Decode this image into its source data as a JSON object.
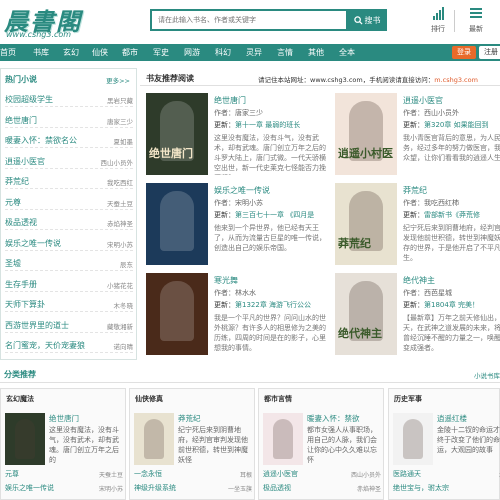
{
  "header": {
    "logo": "晨書閣",
    "logo_url": "www.cshg3.com",
    "search_placeholder": "请在此输入书名、作者或关键字",
    "search_button": "搜书",
    "rank_label": "排行",
    "latest_label": "最新"
  },
  "nav": {
    "items": [
      "首页",
      "书库",
      "玄幻",
      "仙侠",
      "都市",
      "军史",
      "网游",
      "科幻",
      "灵异",
      "言情",
      "其他",
      "全本"
    ],
    "login": "登录",
    "register": "注册"
  },
  "hot": {
    "title": "热门小说",
    "more": "更多>>",
    "items": [
      {
        "title": "校园超级学生",
        "author": "黑岩只藏"
      },
      {
        "title": "绝世唐门",
        "author": "唐家三少"
      },
      {
        "title": "暖妻入怀：禁欲名公",
        "author": "夏如墨"
      },
      {
        "title": "逍遥小医官",
        "author": "西山小员外"
      },
      {
        "title": "莽荒纪",
        "author": "我吃西红"
      },
      {
        "title": "元尊",
        "author": "天蚕土豆"
      },
      {
        "title": "极品透视",
        "author": "赤焰神圣"
      },
      {
        "title": "娱乐之唯一传说",
        "author": "宋明小苏"
      },
      {
        "title": "圣墟",
        "author": "辰东"
      },
      {
        "title": "生存手册",
        "author": "小猪花花"
      },
      {
        "title": "天师下算卦",
        "author": "木冬晓"
      },
      {
        "title": "西游世界里的道士",
        "author": "藏敬湘新"
      },
      {
        "title": "名门蜜宠，天价宠妻狼",
        "author": "诺向晴"
      }
    ]
  },
  "recommend": {
    "title": "书友推荐阅读",
    "notice_prefix": "请记住本站网址：",
    "notice_url": "www.cshg3.com",
    "notice_mid": "，手机阅读请直接访问：",
    "notice_mobile": "m.cshg3.com",
    "update_label": "更新：",
    "books": [
      {
        "name": "绝世唐门",
        "author": "作者：唐家三少",
        "chapter": "第十一章 最弱的班长",
        "desc": "这里没有魔法，没有斗气，没有武术，却有武魂。唐门创立万年之后的斗罗大陆上，唐门式微。一代天骄横空出世，新一代史莱克七怪能否力挽狂澜？",
        "cover_title": "绝世唐门",
        "cover_bg": "#2e3b2a"
      },
      {
        "name": "逍遥小医官",
        "author": "作者：西山小员外",
        "chapter": "第320章 如果能回到",
        "desc": "我小青医官背后的意思，为人民服务，经过多年的努力做医官，我不负众望，让你们看看我的逍遥人生。",
        "cover_title": "逍遥小村医",
        "cover_bg": "#f2e4da"
      },
      {
        "name": "娱乐之唯一传说",
        "author": "作者：宋明小苏",
        "chapter": "第三百七十一章 《四月是",
        "desc": "他来到一个异世界，他已经有天王了，从而为流量古巨星的唯一传说，创造出自己的娱乐帝国。",
        "cover_title": "",
        "cover_bg": "#1c3a5a"
      },
      {
        "name": "莽荒纪",
        "author": "作者：我吃西红柿",
        "chapter": "雷部新书《莽荒修",
        "desc": "纪宁死后来到阴曹地府，经判官审判发现他前世积德，转世到神魔妖怪并存的世界，于是他开启了不平凡的人生。",
        "cover_title": "莽荒纪",
        "cover_bg": "#e8e2d0"
      },
      {
        "name": "寒光舞",
        "author": "作者：林水水",
        "chapter": "第1322章 海游飞行公公",
        "desc": "我是一个平凡的世界？问问山水的世外桃源？有许多人的相思修为之美的历练，四周的时间是在的影子，心里想我的事情。",
        "cover_title": "",
        "cover_bg": "#4a2a1a"
      },
      {
        "name": "绝代神主",
        "author": "作者：西芭星城",
        "chapter": "第1804章 完美！",
        "desc": "【最新章】万年之前天修仙出，出逆天，在武神之道发展的未来，将心中曾经沉睡不醒的力量之一，唤醒灵力变成强者。",
        "cover_title": "绝代神主",
        "cover_bg": "#e6e0d8"
      }
    ]
  },
  "categories": {
    "title": "分类推荐",
    "more": "小说书库",
    "columns": [
      {
        "name": "玄幻魔法",
        "book": "绝世唐门",
        "desc": "这里没有魔法，没有斗气，没有武术，却有武魂。唐门创立万年之后的",
        "cover_bg": "#2e3b2a",
        "rows": [
          {
            "title": "元尊",
            "author": "天蚕土豆"
          },
          {
            "title": "娱乐之唯一传说",
            "author": "宋明小苏"
          }
        ]
      },
      {
        "name": "仙侠修真",
        "book": "莽荒纪",
        "desc": "纪宁死后来到阴曹地府，经判官审判发现他前世积德，转世到神魔妖怪",
        "cover_bg": "#e8e2d0",
        "rows": [
          {
            "title": "一念永恒",
            "author": "耳根"
          },
          {
            "title": "神级升级系统",
            "author": "一坐玉旗"
          }
        ]
      },
      {
        "name": "都市言情",
        "book": "暖妻入怀：禁欲",
        "desc": "都市女强人从事职场，用自己的人脉，我们会让你的心中久久难以忘怀",
        "cover_bg": "#f3e6e8",
        "rows": [
          {
            "title": "逍遥小医官",
            "author": "西山小员外"
          },
          {
            "title": "极品透视",
            "author": "赤焰神圣"
          }
        ]
      },
      {
        "name": "历史军事",
        "book": "逍遥红楼",
        "desc": "金陵十二钗的命运才，终于改变了他们的命运，大观园的故事",
        "cover_bg": "#f2f2f2",
        "rows": [
          {
            "title": "医路通天",
            "author": "水浅"
          },
          {
            "title": "绝世宝与，驸太宗",
            "author": ""
          }
        ]
      }
    ]
  }
}
